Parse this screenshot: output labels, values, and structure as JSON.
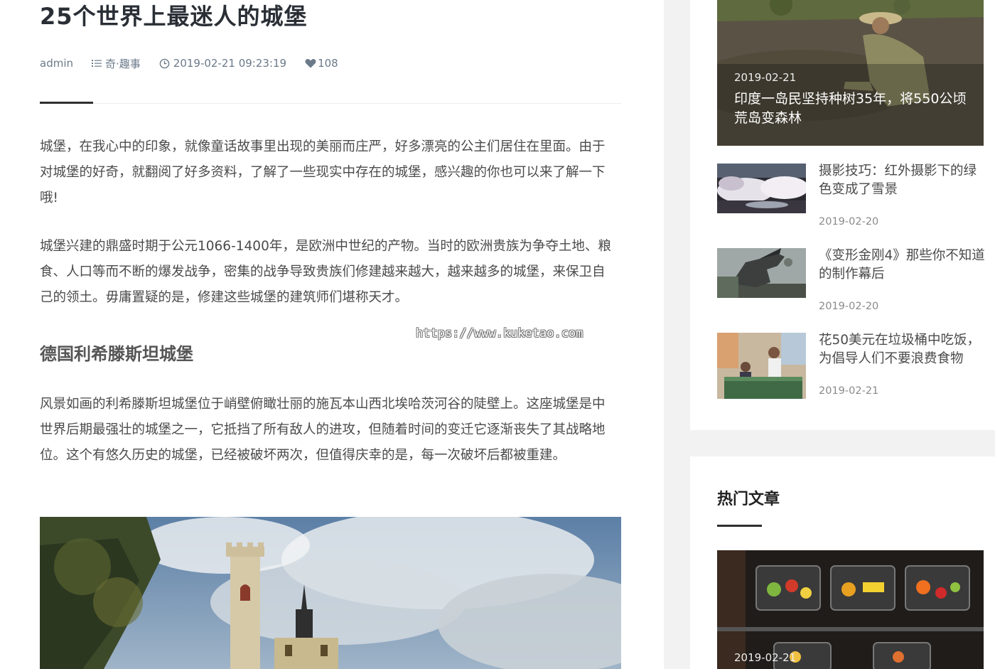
{
  "article": {
    "title": "25个世界上最迷人的城堡",
    "meta": {
      "author": "admin",
      "category": "奇·趣事",
      "datetime": "2019-02-21 09:23:19",
      "likes": "108"
    },
    "paragraphs": [
      "城堡，在我心中的印象，就像童话故事里出现的美丽而庄严，好多漂亮的公主们居住在里面。由于对城堡的好奇，就翻阅了好多资料，了解了一些现实中存在的城堡，感兴趣的你也可以来了解一下哦!",
      "城堡兴建的鼎盛时期于公元1066-1400年，是欧洲中世纪的产物。当时的欧洲贵族为争夺土地、粮食、人口等而不断的爆发战争，密集的战争导致贵族们修建越来越大，越来越多的城堡，来保卫自己的领土。毋庸置疑的是，修建这些城堡的建筑师们堪称天才。"
    ],
    "watermark": "https://www.kuketao.com",
    "section_heading": "德国利希滕斯坦城堡",
    "section_paragraph": "风景如画的利希滕斯坦城堡位于峭壁俯瞰壮丽的施瓦本山西北埃哈茨河谷的陡壁上。这座城堡是中世界后期最强壮的城堡之一，它抵挡了所有敌人的进攻，但随着时间的变迁它逐渐丧失了其战略地位。这个有悠久历史的城堡，已经被破坏两次，但值得庆幸的是，每一次破坏后都被重建。"
  },
  "sidebar": {
    "featured": {
      "date": "2019-02-21",
      "title": "印度一岛民坚持种树35年，将550公顷荒岛变森林"
    },
    "posts": [
      {
        "title": "摄影技巧：红外摄影下的绿色变成了雪景",
        "date": "2019-02-20"
      },
      {
        "title": "《变形金刚4》那些你不知道的制作幕后",
        "date": "2019-02-20"
      },
      {
        "title": "花50美元在垃圾桶中吃饭，为倡导人们不要浪费食物",
        "date": "2019-02-21"
      }
    ],
    "hot": {
      "heading": "热门文章",
      "card_date": "2019-02-21"
    }
  },
  "icons": {
    "category": "list-icon",
    "datetime": "clock-icon",
    "likes": "heart-icon"
  }
}
